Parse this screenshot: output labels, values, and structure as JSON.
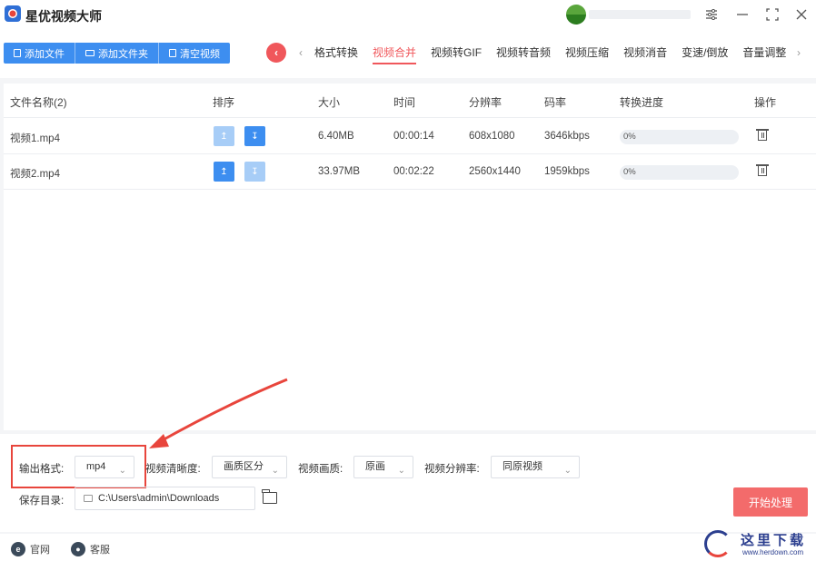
{
  "app": {
    "title": "星优视频大师"
  },
  "toolbar": {
    "buttons": [
      "添加文件",
      "添加文件夹",
      "清空视频"
    ],
    "tabs": [
      "格式转换",
      "视频合并",
      "视频转GIF",
      "视频转音频",
      "视频压缩",
      "视频消音",
      "变速/倒放",
      "音量调整"
    ],
    "active_tab": "视频合并"
  },
  "table": {
    "headers": [
      "文件名称(2)",
      "排序",
      "大小",
      "时间",
      "分辨率",
      "码率",
      "转换进度",
      "操作"
    ],
    "rows": [
      {
        "name": "视频1.mp4",
        "size": "6.40MB",
        "time": "00:00:14",
        "resolution": "608x1080",
        "bitrate": "3646kbps",
        "progress": "0%"
      },
      {
        "name": "视频2.mp4",
        "size": "33.97MB",
        "time": "00:02:22",
        "resolution": "2560x1440",
        "bitrate": "1959kbps",
        "progress": "0%"
      }
    ]
  },
  "settings": {
    "format_label": "输出格式:",
    "format_value": "mp4",
    "clarity_label": "视频清晰度:",
    "clarity_value": "画质区分",
    "quality_label": "视频画质:",
    "quality_value": "原画",
    "resolution_label": "视频分辨率:",
    "resolution_value": "同原视频",
    "save_label": "保存目录:",
    "save_path": "C:\\Users\\admin\\Downloads",
    "start_label": "开始处理"
  },
  "footer": {
    "official": "官网",
    "service": "客服"
  },
  "watermark": {
    "text": "这里下载",
    "url": "www.herdown.com"
  },
  "colors": {
    "primary": "#3d8ef0",
    "accent": "#f0575b",
    "start": "#f36b6b",
    "highlight": "#e8453c"
  }
}
